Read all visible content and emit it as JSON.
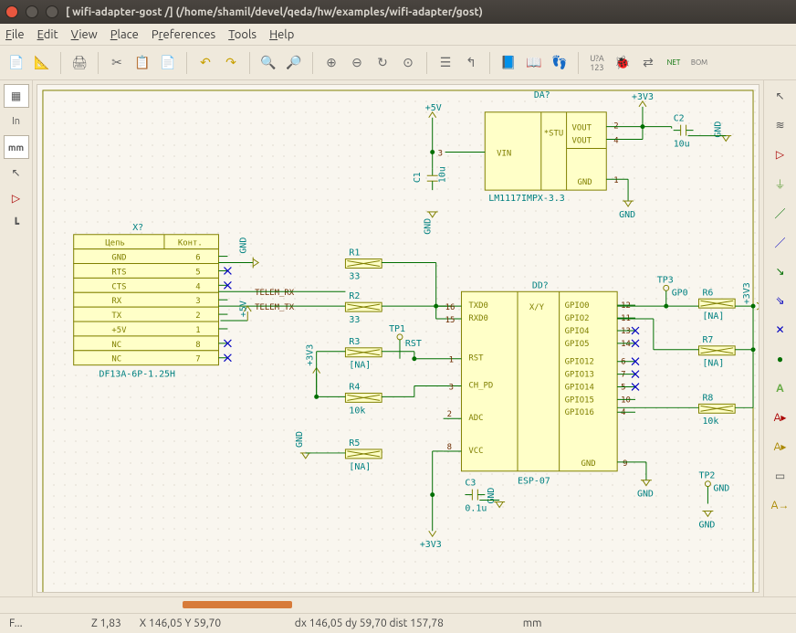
{
  "title": "[ wifi-adapter-gost /] (/home/shamil/devel/qeda/hw/examples/wifi-adapter/gost)",
  "menu": [
    "File",
    "Edit",
    "View",
    "Place",
    "Preferences",
    "Tools",
    "Help"
  ],
  "left_tools": [
    "grid",
    "in",
    "mm",
    "cursor",
    "opamp",
    "hier"
  ],
  "status": {
    "z": "Z 1,83",
    "xy": "X 146,05  Y 59,70",
    "d": "dx 146,05  dy 59,70  dist 157,78",
    "unit": "mm"
  },
  "connector": {
    "ref": "X?",
    "col1": "Цепь",
    "col2": "Конт.",
    "rows": [
      [
        "GND",
        "6"
      ],
      [
        "RTS",
        "5"
      ],
      [
        "CTS",
        "4"
      ],
      [
        "RX",
        "3"
      ],
      [
        "TX",
        "2"
      ],
      [
        "+5V",
        "1"
      ],
      [
        "NC",
        "8"
      ],
      [
        "NC",
        "7"
      ]
    ],
    "foot": "DF13A-6P-1.25H"
  },
  "reg": {
    "ref": "DA?",
    "name": "LM1117IMPX-3.3",
    "pins": {
      "vin": "VIN",
      "stu": "*STU",
      "vout1": "VOUT",
      "vout2": "VOUT",
      "gnd": "GND"
    },
    "pn": {
      "vin": "3",
      "vout1": "2",
      "vout2": "4",
      "gnd": "1"
    }
  },
  "esp": {
    "ref": "DD?",
    "name": "ESP-07",
    "xy": "X/Y",
    "left": [
      [
        "TXD0",
        "16"
      ],
      [
        "RXD0",
        "15"
      ],
      [
        "RST",
        "1"
      ],
      [
        "CH_PD",
        "3"
      ],
      [
        "ADC",
        "2"
      ],
      [
        "VCC",
        "8"
      ]
    ],
    "right": [
      [
        "GPIO0",
        "12"
      ],
      [
        "GPIO2",
        "11"
      ],
      [
        "GPIO4",
        "13"
      ],
      [
        "GPIO5",
        "14"
      ],
      [
        "GPIO12",
        "6"
      ],
      [
        "GPIO13",
        "7"
      ],
      [
        "GPIO14",
        "5"
      ],
      [
        "GPIO15",
        "10"
      ],
      [
        "GPIO16",
        "4"
      ]
    ],
    "gnd": "GND",
    "gndpin": "9"
  },
  "res": [
    {
      "ref": "R1",
      "val": "33"
    },
    {
      "ref": "R2",
      "val": "33"
    },
    {
      "ref": "R3",
      "val": "[NA]"
    },
    {
      "ref": "R4",
      "val": "10k"
    },
    {
      "ref": "R5",
      "val": "[NA]"
    },
    {
      "ref": "R6",
      "val": "[NA]"
    },
    {
      "ref": "R7",
      "val": "[NA]"
    },
    {
      "ref": "R8",
      "val": "10k"
    }
  ],
  "cap": [
    {
      "ref": "C1",
      "val": "10u"
    },
    {
      "ref": "C2",
      "val": "10u"
    },
    {
      "ref": "C3",
      "val": "0.1u"
    }
  ],
  "tp": [
    {
      "ref": "TP1",
      "lbl": "RST"
    },
    {
      "ref": "TP2",
      "lbl": "GND"
    },
    {
      "ref": "TP3",
      "lbl": "GP0"
    }
  ],
  "power": {
    "p5v": "+5V",
    "p3v3": "+3V3",
    "gnd": "GND"
  },
  "nets": {
    "rx": "TELEM_RX",
    "tx": "TELEM_TX"
  },
  "chart_data": {
    "type": "table",
    "title": "schematic components",
    "components": [
      {
        "ref": "X?",
        "type": "connector",
        "value": "DF13A-6P-1.25H",
        "pins": 8
      },
      {
        "ref": "DA?",
        "type": "regulator",
        "value": "LM1117IMPX-3.3"
      },
      {
        "ref": "DD?",
        "type": "module",
        "value": "ESP-07"
      },
      {
        "ref": "R1",
        "type": "resistor",
        "value": "33"
      },
      {
        "ref": "R2",
        "type": "resistor",
        "value": "33"
      },
      {
        "ref": "R3",
        "type": "resistor",
        "value": "[NA]"
      },
      {
        "ref": "R4",
        "type": "resistor",
        "value": "10k"
      },
      {
        "ref": "R5",
        "type": "resistor",
        "value": "[NA]"
      },
      {
        "ref": "R6",
        "type": "resistor",
        "value": "[NA]"
      },
      {
        "ref": "R7",
        "type": "resistor",
        "value": "[NA]"
      },
      {
        "ref": "R8",
        "type": "resistor",
        "value": "10k"
      },
      {
        "ref": "C1",
        "type": "capacitor",
        "value": "10u"
      },
      {
        "ref": "C2",
        "type": "capacitor",
        "value": "10u"
      },
      {
        "ref": "C3",
        "type": "capacitor",
        "value": "0.1u"
      },
      {
        "ref": "TP1",
        "type": "testpoint",
        "value": "RST"
      },
      {
        "ref": "TP2",
        "type": "testpoint",
        "value": "GND"
      },
      {
        "ref": "TP3",
        "type": "testpoint",
        "value": "GP0"
      }
    ],
    "nets": [
      "+5V",
      "+3V3",
      "GND",
      "TELEM_RX",
      "TELEM_TX"
    ]
  }
}
